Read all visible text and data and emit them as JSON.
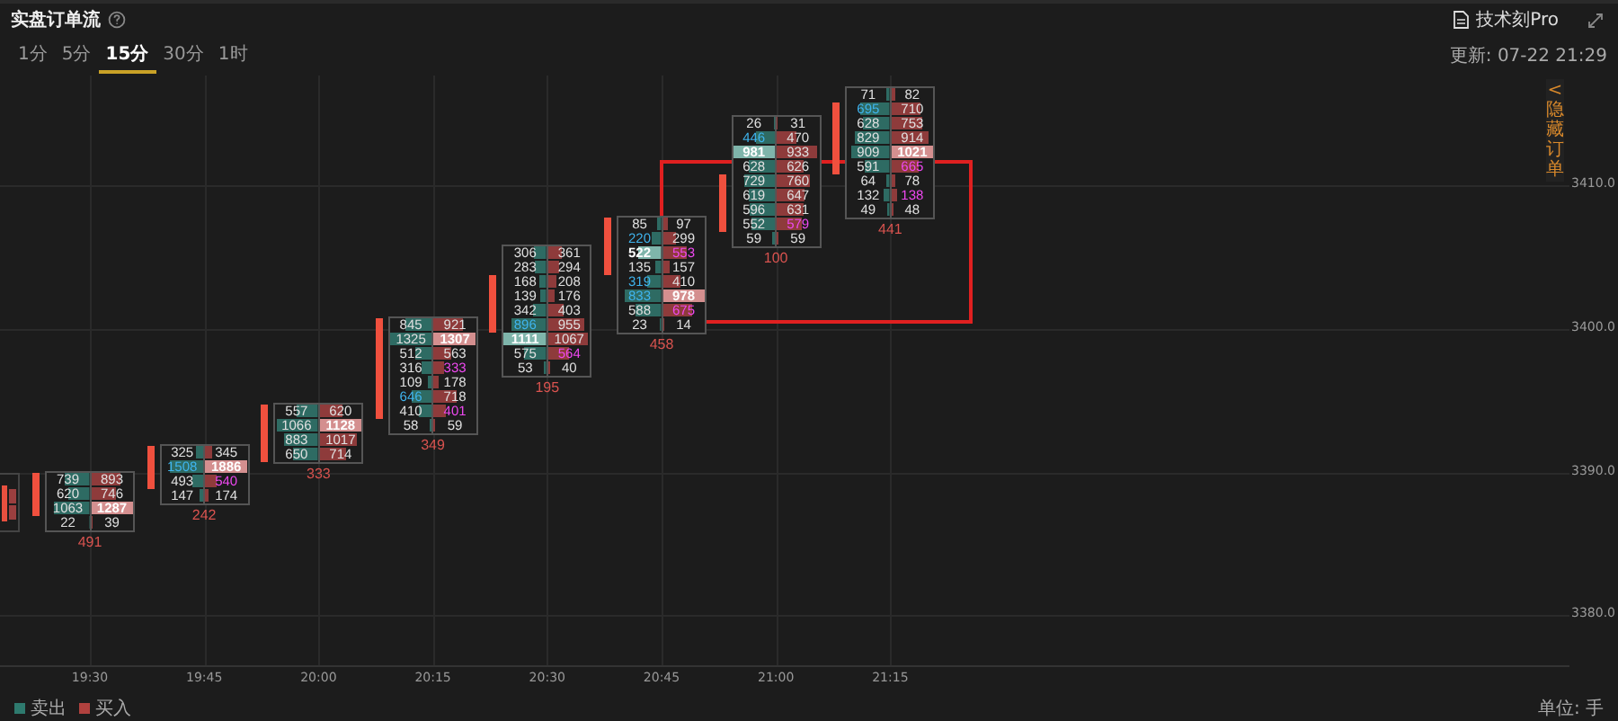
{
  "header": {
    "title": "实盘订单流",
    "pro_link": "技术刻Pro"
  },
  "tabs": [
    {
      "label": "1分",
      "selected": false
    },
    {
      "label": "5分",
      "selected": false
    },
    {
      "label": "15分",
      "selected": true
    },
    {
      "label": "30分",
      "selected": false
    },
    {
      "label": "1时",
      "selected": false
    }
  ],
  "updated": "更新: 07-22 21:29",
  "side_tab": {
    "arrow": "<",
    "label": "隐藏订单"
  },
  "price_labels": [
    "3410.0",
    "3400.0",
    "3390.0",
    "3380.0"
  ],
  "time_labels": [
    "19:30",
    "19:45",
    "20:00",
    "20:15",
    "20:30",
    "20:45",
    "21:00",
    "21:15"
  ],
  "annotation_box": true,
  "candles": [
    {
      "total": "491",
      "rows": [
        {
          "body": true,
          "sell": {
            "text": "739",
            "kind": "plain"
          },
          "buy": {
            "text": "893",
            "kind": "plain"
          }
        },
        {
          "body": true,
          "sell": {
            "text": "620",
            "kind": "plain"
          },
          "buy": {
            "text": "746",
            "kind": "plain"
          }
        },
        {
          "body": true,
          "sell": {
            "text": "1063",
            "kind": "plain"
          },
          "buy": {
            "text": "1287",
            "kind": "strong"
          }
        },
        {
          "body": false,
          "sell": {
            "text": "22",
            "kind": "plain"
          },
          "buy": {
            "text": "39",
            "kind": "plain"
          }
        }
      ]
    },
    {
      "total": "242",
      "rows": [
        {
          "body": true,
          "sell": {
            "text": "325",
            "kind": "plain"
          },
          "buy": {
            "text": "345",
            "kind": "plain"
          }
        },
        {
          "body": true,
          "sell": {
            "text": "1508",
            "kind": "blue"
          },
          "buy": {
            "text": "1886",
            "kind": "strong"
          }
        },
        {
          "body": true,
          "sell": {
            "text": "493",
            "kind": "plain"
          },
          "buy": {
            "text": "540",
            "kind": "magenta"
          }
        },
        {
          "body": false,
          "sell": {
            "text": "147",
            "kind": "plain"
          },
          "buy": {
            "text": "174",
            "kind": "plain"
          }
        }
      ]
    },
    {
      "total": "333",
      "rows": [
        {
          "body": true,
          "sell": {
            "text": "557",
            "kind": "plain"
          },
          "buy": {
            "text": "620",
            "kind": "plain"
          }
        },
        {
          "body": true,
          "sell": {
            "text": "1066",
            "kind": "plain"
          },
          "buy": {
            "text": "1128",
            "kind": "strong"
          }
        },
        {
          "body": true,
          "sell": {
            "text": "883",
            "kind": "plain"
          },
          "buy": {
            "text": "1017",
            "kind": "plain"
          }
        },
        {
          "body": true,
          "sell": {
            "text": "650",
            "kind": "plain"
          },
          "buy": {
            "text": "714",
            "kind": "plain"
          }
        }
      ]
    },
    {
      "total": "349",
      "rows": [
        {
          "body": true,
          "sell": {
            "text": "845",
            "kind": "plain"
          },
          "buy": {
            "text": "921",
            "kind": "plain"
          }
        },
        {
          "body": true,
          "sell": {
            "text": "1325",
            "kind": "plain"
          },
          "buy": {
            "text": "1307",
            "kind": "strong"
          }
        },
        {
          "body": true,
          "sell": {
            "text": "512",
            "kind": "plain"
          },
          "buy": {
            "text": "563",
            "kind": "plain"
          }
        },
        {
          "body": true,
          "sell": {
            "text": "316",
            "kind": "plain"
          },
          "buy": {
            "text": "333",
            "kind": "magenta"
          }
        },
        {
          "body": true,
          "sell": {
            "text": "109",
            "kind": "plain"
          },
          "buy": {
            "text": "178",
            "kind": "plain"
          }
        },
        {
          "body": true,
          "sell": {
            "text": "646",
            "kind": "blue"
          },
          "buy": {
            "text": "718",
            "kind": "plain"
          }
        },
        {
          "body": true,
          "sell": {
            "text": "410",
            "kind": "plain"
          },
          "buy": {
            "text": "401",
            "kind": "magenta"
          }
        },
        {
          "body": false,
          "sell": {
            "text": "58",
            "kind": "plain"
          },
          "buy": {
            "text": "59",
            "kind": "plain"
          }
        }
      ]
    },
    {
      "total": "195",
      "rows": [
        {
          "body": false,
          "sell": {
            "text": "306",
            "kind": "plain"
          },
          "buy": {
            "text": "361",
            "kind": "plain"
          }
        },
        {
          "body": false,
          "sell": {
            "text": "283",
            "kind": "plain"
          },
          "buy": {
            "text": "294",
            "kind": "plain"
          }
        },
        {
          "body": true,
          "sell": {
            "text": "168",
            "kind": "plain"
          },
          "buy": {
            "text": "208",
            "kind": "plain"
          }
        },
        {
          "body": true,
          "sell": {
            "text": "139",
            "kind": "plain"
          },
          "buy": {
            "text": "176",
            "kind": "plain"
          }
        },
        {
          "body": true,
          "sell": {
            "text": "342",
            "kind": "plain"
          },
          "buy": {
            "text": "403",
            "kind": "plain"
          }
        },
        {
          "body": true,
          "sell": {
            "text": "896",
            "kind": "blue"
          },
          "buy": {
            "text": "955",
            "kind": "plain"
          }
        },
        {
          "body": false,
          "sell": {
            "text": "1111",
            "kind": "strong"
          },
          "buy": {
            "text": "1067",
            "kind": "plain"
          }
        },
        {
          "body": false,
          "sell": {
            "text": "575",
            "kind": "plain"
          },
          "buy": {
            "text": "564",
            "kind": "magenta"
          }
        },
        {
          "body": false,
          "sell": {
            "text": "53",
            "kind": "plain"
          },
          "buy": {
            "text": "40",
            "kind": "plain"
          }
        }
      ]
    },
    {
      "total": "458",
      "rows": [
        {
          "body": true,
          "sell": {
            "text": "85",
            "kind": "plain"
          },
          "buy": {
            "text": "97",
            "kind": "plain"
          }
        },
        {
          "body": true,
          "sell": {
            "text": "220",
            "kind": "blue"
          },
          "buy": {
            "text": "299",
            "kind": "plain"
          }
        },
        {
          "body": true,
          "sell": {
            "text": "522",
            "kind": "strong"
          },
          "buy": {
            "text": "553",
            "kind": "magenta"
          }
        },
        {
          "body": true,
          "sell": {
            "text": "135",
            "kind": "plain"
          },
          "buy": {
            "text": "157",
            "kind": "plain"
          }
        },
        {
          "body": false,
          "sell": {
            "text": "319",
            "kind": "blue"
          },
          "buy": {
            "text": "410",
            "kind": "plain"
          }
        },
        {
          "body": false,
          "sell": {
            "text": "833",
            "kind": "blue"
          },
          "buy": {
            "text": "978",
            "kind": "strong"
          }
        },
        {
          "body": false,
          "sell": {
            "text": "588",
            "kind": "plain"
          },
          "buy": {
            "text": "675",
            "kind": "magenta"
          }
        },
        {
          "body": false,
          "sell": {
            "text": "23",
            "kind": "plain"
          },
          "buy": {
            "text": "14",
            "kind": "plain"
          }
        }
      ]
    },
    {
      "total": "100",
      "rows": [
        {
          "body": false,
          "sell": {
            "text": "26",
            "kind": "plain"
          },
          "buy": {
            "text": "31",
            "kind": "plain"
          }
        },
        {
          "body": false,
          "sell": {
            "text": "446",
            "kind": "blue"
          },
          "buy": {
            "text": "470",
            "kind": "plain"
          }
        },
        {
          "body": false,
          "sell": {
            "text": "981",
            "kind": "strong"
          },
          "buy": {
            "text": "933",
            "kind": "plain"
          }
        },
        {
          "body": false,
          "sell": {
            "text": "628",
            "kind": "plain"
          },
          "buy": {
            "text": "626",
            "kind": "plain"
          }
        },
        {
          "body": true,
          "sell": {
            "text": "729",
            "kind": "plain"
          },
          "buy": {
            "text": "760",
            "kind": "plain"
          }
        },
        {
          "body": true,
          "sell": {
            "text": "619",
            "kind": "plain"
          },
          "buy": {
            "text": "647",
            "kind": "plain"
          }
        },
        {
          "body": true,
          "sell": {
            "text": "596",
            "kind": "plain"
          },
          "buy": {
            "text": "631",
            "kind": "plain"
          }
        },
        {
          "body": true,
          "sell": {
            "text": "552",
            "kind": "plain"
          },
          "buy": {
            "text": "579",
            "kind": "magenta"
          }
        },
        {
          "body": false,
          "sell": {
            "text": "59",
            "kind": "plain"
          },
          "buy": {
            "text": "59",
            "kind": "plain"
          }
        }
      ]
    },
    {
      "total": "441",
      "rows": [
        {
          "body": false,
          "sell": {
            "text": "71",
            "kind": "plain"
          },
          "buy": {
            "text": "82",
            "kind": "plain"
          }
        },
        {
          "body": true,
          "sell": {
            "text": "695",
            "kind": "blue"
          },
          "buy": {
            "text": "710",
            "kind": "plain"
          }
        },
        {
          "body": true,
          "sell": {
            "text": "628",
            "kind": "plain"
          },
          "buy": {
            "text": "753",
            "kind": "plain"
          }
        },
        {
          "body": true,
          "sell": {
            "text": "829",
            "kind": "plain"
          },
          "buy": {
            "text": "914",
            "kind": "plain"
          }
        },
        {
          "body": true,
          "sell": {
            "text": "909",
            "kind": "plain"
          },
          "buy": {
            "text": "1021",
            "kind": "strong"
          }
        },
        {
          "body": true,
          "sell": {
            "text": "591",
            "kind": "plain"
          },
          "buy": {
            "text": "665",
            "kind": "magenta"
          }
        },
        {
          "body": false,
          "sell": {
            "text": "64",
            "kind": "plain"
          },
          "buy": {
            "text": "78",
            "kind": "plain"
          }
        },
        {
          "body": false,
          "sell": {
            "text": "132",
            "kind": "plain"
          },
          "buy": {
            "text": "138",
            "kind": "magenta"
          }
        },
        {
          "body": false,
          "sell": {
            "text": "49",
            "kind": "plain"
          },
          "buy": {
            "text": "48",
            "kind": "plain"
          }
        }
      ]
    }
  ],
  "legend": [
    {
      "label": "卖出",
      "color": "#2e7a6e"
    },
    {
      "label": "买入",
      "color": "#b0413e"
    }
  ],
  "unit": "单位: 手"
}
